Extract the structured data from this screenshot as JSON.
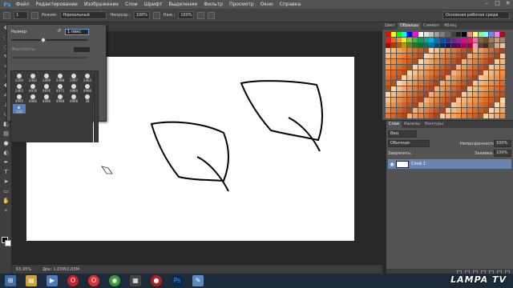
{
  "menu": {
    "logo": "Ps",
    "items": [
      "Файл",
      "Редактирование",
      "Изображение",
      "Слои",
      "Шрифт",
      "Выделение",
      "Фильтр",
      "Просмотр",
      "Окно",
      "Справка"
    ]
  },
  "options": {
    "brush_size_value": "1",
    "mode_label": "Режим:",
    "mode_value": "Нормальный",
    "opacity_label": "Непрозр.:",
    "opacity_value": "100%",
    "flow_label": "Наж.:",
    "flow_value": "100%",
    "workspace": "Основная рабочая среда"
  },
  "brush_popup": {
    "size_label": "Размер:",
    "size_value": "1 пикс",
    "hardness_label": "Жесткость:",
    "brushes": [
      "2500",
      "2492",
      "2499",
      "2498",
      "2497",
      "2463",
      "2465",
      "4976",
      "4976",
      "4975",
      "4984",
      "4996",
      "4995",
      "4986",
      "4996",
      "4998",
      "4998",
      "38",
      "618"
    ]
  },
  "status": {
    "zoom": "63,95%",
    "doc": "Док: 1,03М/2,03М"
  },
  "panels": {
    "top_tabs": [
      "Цвет",
      "Образцы",
      "Символ",
      "Абзац"
    ],
    "layer_tabs": [
      "Слои",
      "Каналы",
      "Контуры"
    ],
    "kind_label": "Вид",
    "blend_mode": "Обычные",
    "opacity_label": "Непрозрачность:",
    "opacity_value": "100%",
    "lock_label": "Закрепить:",
    "fill_label": "Заливка:",
    "fill_value": "100%",
    "layer_name": "Слой 1"
  },
  "watermark": "LAMPA TV",
  "colors": {
    "accent": "#31a8ff",
    "selected_layer": "#6885b2",
    "taskbar": "#1d2a3a"
  }
}
